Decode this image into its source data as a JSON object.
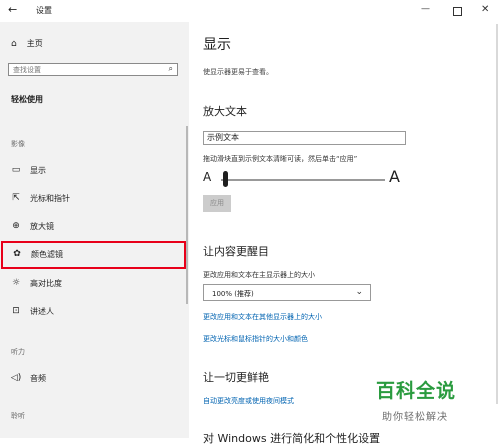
{
  "window": {
    "title": "设置",
    "back_icon": "arrow-left-icon",
    "min_symbol": "—",
    "close_symbol": "✕"
  },
  "sidebar": {
    "home_label": "主页",
    "home_icon": "home-icon",
    "search_placeholder": "查找设置",
    "section_title": "轻松使用",
    "groups": [
      {
        "label": "影像",
        "items": [
          {
            "label": "显示",
            "icon": "monitor-icon",
            "glyph": "▭"
          },
          {
            "label": "光标和指针",
            "icon": "cursor-icon",
            "glyph": "⇱"
          },
          {
            "label": "放大镜",
            "icon": "magnifier-icon",
            "glyph": "⊕"
          },
          {
            "label": "颜色滤镜",
            "icon": "palette-icon",
            "glyph": "✿",
            "selected": true
          },
          {
            "label": "高对比度",
            "icon": "contrast-icon",
            "glyph": "☼"
          },
          {
            "label": "讲述人",
            "icon": "narrator-icon",
            "glyph": "⊡"
          }
        ]
      },
      {
        "label": "听力",
        "items": [
          {
            "label": "音频",
            "icon": "speaker-icon",
            "glyph": "◁)"
          }
        ]
      },
      {
        "label": "聆听",
        "items": []
      }
    ]
  },
  "main": {
    "title": "显示",
    "description": "使显示器更易于查看。",
    "enlarge_text": {
      "heading": "放大文本",
      "sample_text": "示例文本",
      "slider_description": "拖动滑块直到示例文本清晰可读，然后单击“应用”",
      "slider_min_label": "A",
      "slider_max_label": "A",
      "slider_value_fraction": 0.0,
      "apply_label": "应用"
    },
    "make_bigger": {
      "heading": "让内容更醒目",
      "size_label": "更改应用和文本在主显示器上的大小",
      "size_value": "100% (推荐)",
      "link_other_displays": "更改应用和文本在其他显示器上的大小",
      "link_cursor": "更改光标和鼠标指针的大小和颜色"
    },
    "brighter": {
      "heading": "让一切更鲜艳",
      "link_brightness": "自动更改亮度或使用夜间模式"
    },
    "cut_off_heading": "对 Windows 进行简化和个性化设置"
  },
  "watermark": {
    "main": "百科全说",
    "sub": "助你轻松解决"
  },
  "colors": {
    "accent": "#0063b1",
    "highlight_box": "#e8001a",
    "watermark": "#2a9b3f"
  }
}
